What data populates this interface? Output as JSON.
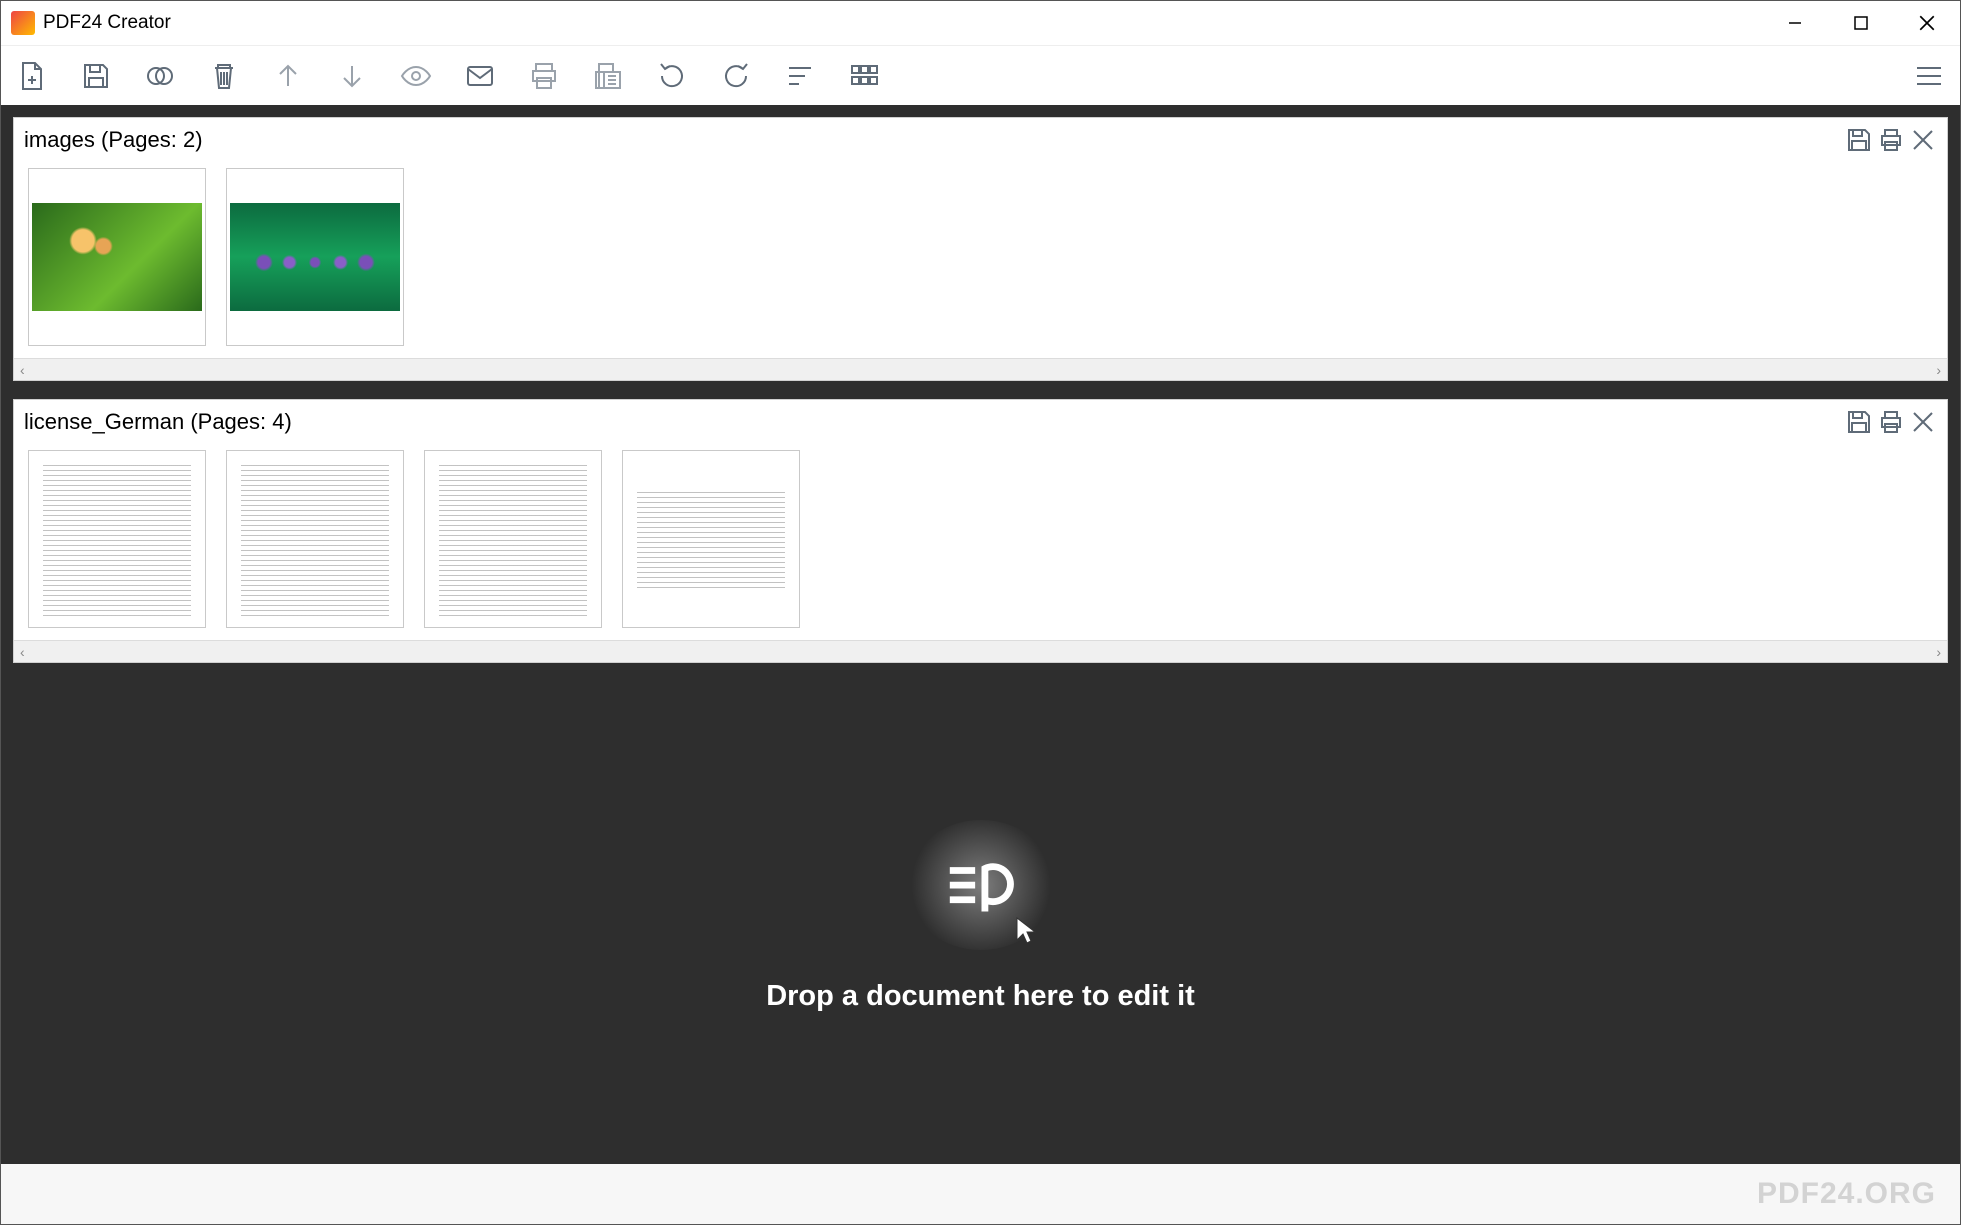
{
  "app": {
    "title": "PDF24 Creator"
  },
  "toolbar": {
    "icons": [
      "new-file-icon",
      "save-icon",
      "merge-icon",
      "delete-icon",
      "arrow-up-icon",
      "arrow-down-icon",
      "preview-icon",
      "email-icon",
      "print-icon",
      "fax-icon",
      "rotate-left-icon",
      "rotate-right-icon",
      "sort-icon",
      "grid-icon"
    ]
  },
  "documents": [
    {
      "name": "images",
      "pages_label": "(Pages: 2)",
      "page_count": 2,
      "thumbs": [
        "photo1",
        "photo2"
      ]
    },
    {
      "name": "license_German",
      "pages_label": "(Pages: 4)",
      "page_count": 4,
      "thumbs": [
        "text",
        "text",
        "text",
        "text-short"
      ]
    }
  ],
  "dropzone": {
    "text": "Drop a document here to edit it"
  },
  "footer": {
    "brand": "PDF24.ORG"
  },
  "doc_actions": {
    "save": "save",
    "print": "print",
    "close": "close"
  }
}
